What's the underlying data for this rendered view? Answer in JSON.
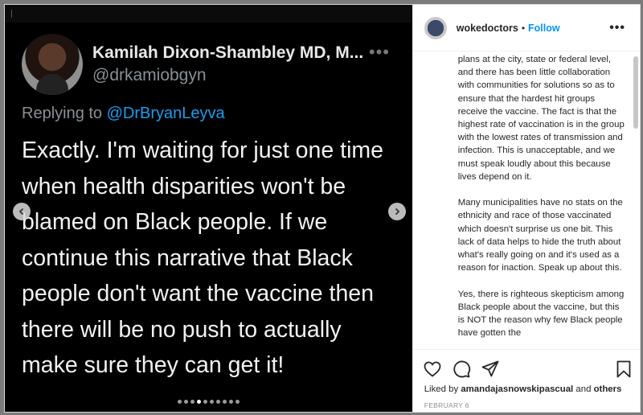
{
  "tweet": {
    "display_name": "Kamilah Dixon-Shambley MD, M...",
    "handle": "@drkamiobgyn",
    "replying_prefix": "Replying to ",
    "replying_to": "@DrBryanLeyva",
    "more": "•••",
    "text": "Exactly.  I'm waiting for just one time when health disparities won't be blamed on Black people.  If we continue this narrative that Black people don't want the vaccine then there will be no push to actually make sure they can get it!"
  },
  "carousel": {
    "prev_icon": "chevron-left-icon",
    "next_icon": "chevron-right-icon",
    "dot_count": 10,
    "active_dot": 3
  },
  "sidebar": {
    "username": "wokedoctors",
    "separator": "•",
    "follow_label": "Follow",
    "more": "•••",
    "caption_paragraphs": [
      "plans at the city, state or federal level, and there has been little collaboration with communities for solutions so as to ensure that the hardest hit groups receive the vaccine. The fact is that the highest rate of vaccination is in the group with the lowest rates of transmission and infection. This is unacceptable, and we must speak loudly about this because lives depend on it.",
      "Many municipalities have no stats on the ethnicity and race of those vaccinated which doesn't surprise us one bit. This lack of data helps to hide the truth about what's really going on and it's used as a reason for inaction. Speak up about this.",
      "Yes, there is righteous skepticism among Black people about the vaccine, but this is NOT the reason why few Black people have gotten the"
    ],
    "likes_prefix": "Liked by ",
    "likes_user": "amandajasnowskipascual",
    "likes_and": " and ",
    "likes_others": "others",
    "date": "FEBRUARY 6"
  },
  "colors": {
    "accent": "#0095f6",
    "mention": "#1d9bf0",
    "media_bg": "#000000"
  }
}
